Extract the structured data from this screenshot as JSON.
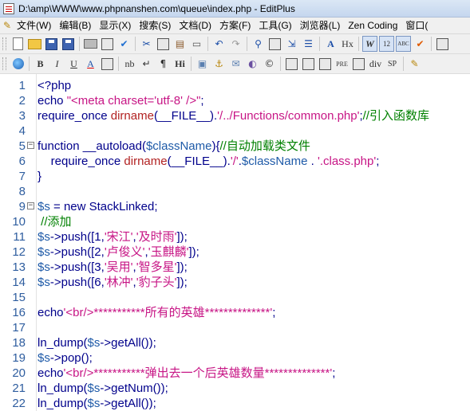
{
  "window": {
    "title": "D:\\amp\\WWW\\www.phpnanshen.com\\queue\\index.php - EditPlus"
  },
  "menu": {
    "items": [
      "文件(W)",
      "编辑(B)",
      "显示(X)",
      "搜索(S)",
      "文档(D)",
      "方案(F)",
      "工具(G)",
      "浏览器(L)",
      "Zen Coding",
      "窗口("
    ]
  },
  "toolbar1": {
    "buttons": [
      "new-file",
      "open-file",
      "save",
      "save-all",
      "print",
      "print-preview",
      "spell-check",
      "cut",
      "copy",
      "paste",
      "delete",
      "undo",
      "redo",
      "find",
      "replace",
      "goto",
      "find-in-files",
      "font-size",
      "hex-view",
      "word-wrap",
      "line-numbers",
      "column-numbers",
      "check",
      "more"
    ],
    "labels": {
      "font_size": "A",
      "hex": "Hx",
      "wrap": "W",
      "linenum": "12",
      "colnum": "ABC"
    }
  },
  "toolbar2": {
    "labels": {
      "bold": "B",
      "italic": "I",
      "underline": "U",
      "font": "A",
      "nbsp": "nb",
      "br": "↵",
      "para": "¶",
      "heading": "Hi",
      "image": "▣",
      "anchor": "⚓",
      "email": "✉",
      "color": "◐",
      "copyright": "©",
      "pre": "PRE",
      "div": "div",
      "span": "SP"
    }
  },
  "editor": {
    "lines": [
      {
        "n": "1",
        "fold": "",
        "parts": [
          [
            "k",
            "<?php"
          ]
        ]
      },
      {
        "n": "2",
        "fold": "",
        "parts": [
          [
            "k",
            "echo "
          ],
          [
            "s",
            "\"<meta charset='utf-8' />\""
          ],
          [
            "k",
            ";"
          ]
        ]
      },
      {
        "n": "3",
        "fold": "",
        "parts": [
          [
            "k",
            "require_once "
          ],
          [
            "f",
            "dirname"
          ],
          [
            "k",
            "(__FILE__)."
          ],
          [
            "s",
            "'/../Functions/common.php'"
          ],
          [
            "k",
            ";"
          ],
          [
            "c",
            "//引入函数库"
          ]
        ]
      },
      {
        "n": "4",
        "fold": "",
        "parts": []
      },
      {
        "n": "5",
        "fold": "⊟",
        "parts": [
          [
            "k",
            "function __autoload("
          ],
          [
            "v",
            "$className"
          ],
          [
            "k",
            "){"
          ],
          [
            "c",
            "//自动加载类文件"
          ]
        ]
      },
      {
        "n": "6",
        "fold": "",
        "parts": [
          [
            "k",
            "    require_once "
          ],
          [
            "f",
            "dirname"
          ],
          [
            "k",
            "(__FILE__)."
          ],
          [
            "s",
            "'/'"
          ],
          [
            "k",
            "."
          ],
          [
            "v",
            "$className"
          ],
          [
            "k",
            " . "
          ],
          [
            "s",
            "'.class.php'"
          ],
          [
            "k",
            ";"
          ]
        ]
      },
      {
        "n": "7",
        "fold": "",
        "parts": [
          [
            "k",
            "}"
          ]
        ]
      },
      {
        "n": "8",
        "fold": "",
        "parts": []
      },
      {
        "n": "9",
        "fold": "⊟",
        "parts": [
          [
            "v",
            "$s"
          ],
          [
            "k",
            " = new StackLinked;"
          ]
        ]
      },
      {
        "n": "10",
        "fold": "",
        "parts": [
          [
            "c",
            " //添加"
          ]
        ]
      },
      {
        "n": "11",
        "fold": "",
        "parts": [
          [
            "v",
            "$s"
          ],
          [
            "k",
            "->push([1,"
          ],
          [
            "s",
            "'宋江'"
          ],
          [
            "k",
            ","
          ],
          [
            "s",
            "'及时雨'"
          ],
          [
            "k",
            "]);"
          ]
        ]
      },
      {
        "n": "12",
        "fold": "",
        "parts": [
          [
            "v",
            "$s"
          ],
          [
            "k",
            "->push([2,"
          ],
          [
            "s",
            "'卢俊义'"
          ],
          [
            "k",
            ","
          ],
          [
            "s",
            "'玉麒麟'"
          ],
          [
            "k",
            "]);"
          ]
        ]
      },
      {
        "n": "13",
        "fold": "",
        "parts": [
          [
            "v",
            "$s"
          ],
          [
            "k",
            "->push([3,"
          ],
          [
            "s",
            "'吴用'"
          ],
          [
            "k",
            ","
          ],
          [
            "s",
            "'智多星'"
          ],
          [
            "k",
            "]);"
          ]
        ]
      },
      {
        "n": "14",
        "fold": "",
        "parts": [
          [
            "v",
            "$s"
          ],
          [
            "k",
            "->push([6,"
          ],
          [
            "s",
            "'林冲'"
          ],
          [
            "k",
            ","
          ],
          [
            "s",
            "'豹子头'"
          ],
          [
            "k",
            "]);"
          ]
        ]
      },
      {
        "n": "15",
        "fold": "",
        "parts": []
      },
      {
        "n": "16",
        "fold": "",
        "parts": [
          [
            "k",
            "echo"
          ],
          [
            "s",
            "'<br/>***********所有的英雄**************'"
          ],
          [
            "k",
            ";"
          ]
        ]
      },
      {
        "n": "17",
        "fold": "",
        "parts": []
      },
      {
        "n": "18",
        "fold": "",
        "parts": [
          [
            "k",
            "ln_dump("
          ],
          [
            "v",
            "$s"
          ],
          [
            "k",
            "->getAll());"
          ]
        ]
      },
      {
        "n": "19",
        "fold": "",
        "parts": [
          [
            "v",
            "$s"
          ],
          [
            "k",
            "->pop();"
          ]
        ]
      },
      {
        "n": "20",
        "fold": "",
        "parts": [
          [
            "k",
            "echo"
          ],
          [
            "s",
            "'<br/>***********弹出去一个后英雄数量**************'"
          ],
          [
            "k",
            ";"
          ]
        ]
      },
      {
        "n": "21",
        "fold": "",
        "parts": [
          [
            "k",
            "ln_dump("
          ],
          [
            "v",
            "$s"
          ],
          [
            "k",
            "->getNum());"
          ]
        ]
      },
      {
        "n": "22",
        "fold": "",
        "parts": [
          [
            "k",
            "ln_dump("
          ],
          [
            "v",
            "$s"
          ],
          [
            "k",
            "->getAll());"
          ]
        ]
      }
    ]
  }
}
